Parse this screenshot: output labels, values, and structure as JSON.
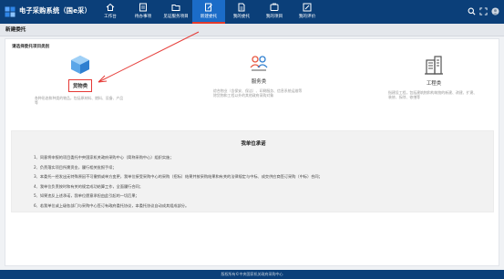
{
  "header": {
    "app_title": "电子采购系统（国e采）",
    "nav": [
      {
        "label": "工作台",
        "icon": "home-icon"
      },
      {
        "label": "待办事项",
        "icon": "checklist-icon"
      },
      {
        "label": "见证服务项目",
        "icon": "folder-icon"
      },
      {
        "label": "新建委托",
        "icon": "edit-doc-icon",
        "active": true
      },
      {
        "label": "我的委托",
        "icon": "document-icon"
      },
      {
        "label": "我的项目",
        "icon": "box-icon"
      },
      {
        "label": "我的评价",
        "icon": "pen-icon"
      }
    ]
  },
  "breadcrumb": "新建委托",
  "main": {
    "section_label": "请选择委托项目类别",
    "categories": [
      {
        "name": "货物类",
        "desc": "各种形态和种类的物品，包括原材料、燃料、设备、产品等",
        "icon": "cube-icon",
        "highlighted": true
      },
      {
        "name": "服务类",
        "desc": "综合物业（含保安、保洁）、印刷服务、信息系统运维等除货物和工程以外的其他政府采购对象",
        "icon": "people-service-icon"
      },
      {
        "name": "工程类",
        "desc": "指建设工程，包括建筑物和构筑物的新建、改建、扩建、装修、拆除、修缮等",
        "icon": "building-icon"
      }
    ]
  },
  "commitment": {
    "title": "我单位承诺",
    "items": [
      "1、同意将申报的项目委托中央国家机关政府采购中心（简称采购中心）组织实施；",
      "2、负责落实项目所需资金，履行相关批报手续；",
      "3、本委托一经发出无特殊原因不可撤销或单方变更，我单位接受采购中心的采购（招标）结果并按采购结果和有关的法律规定与中标、成交供应商签订采购（中标）合同；",
      "4、我单位负责按时和有关的规定成功结算工作，全面履行合同；",
      "5、如果违反上述承诺，我单位愿意承担由此引起的一切后果；",
      "6、若我单位或上级各部门与采购中心签订有政府委托协议，本委托协议自动成其组成部分。"
    ]
  },
  "footer": "版权所有©中央国家机关政府采购中心",
  "colors": {
    "header_bg": "#0b3f79",
    "active_tab": "#1b6cc8",
    "highlight": "#e53935"
  }
}
